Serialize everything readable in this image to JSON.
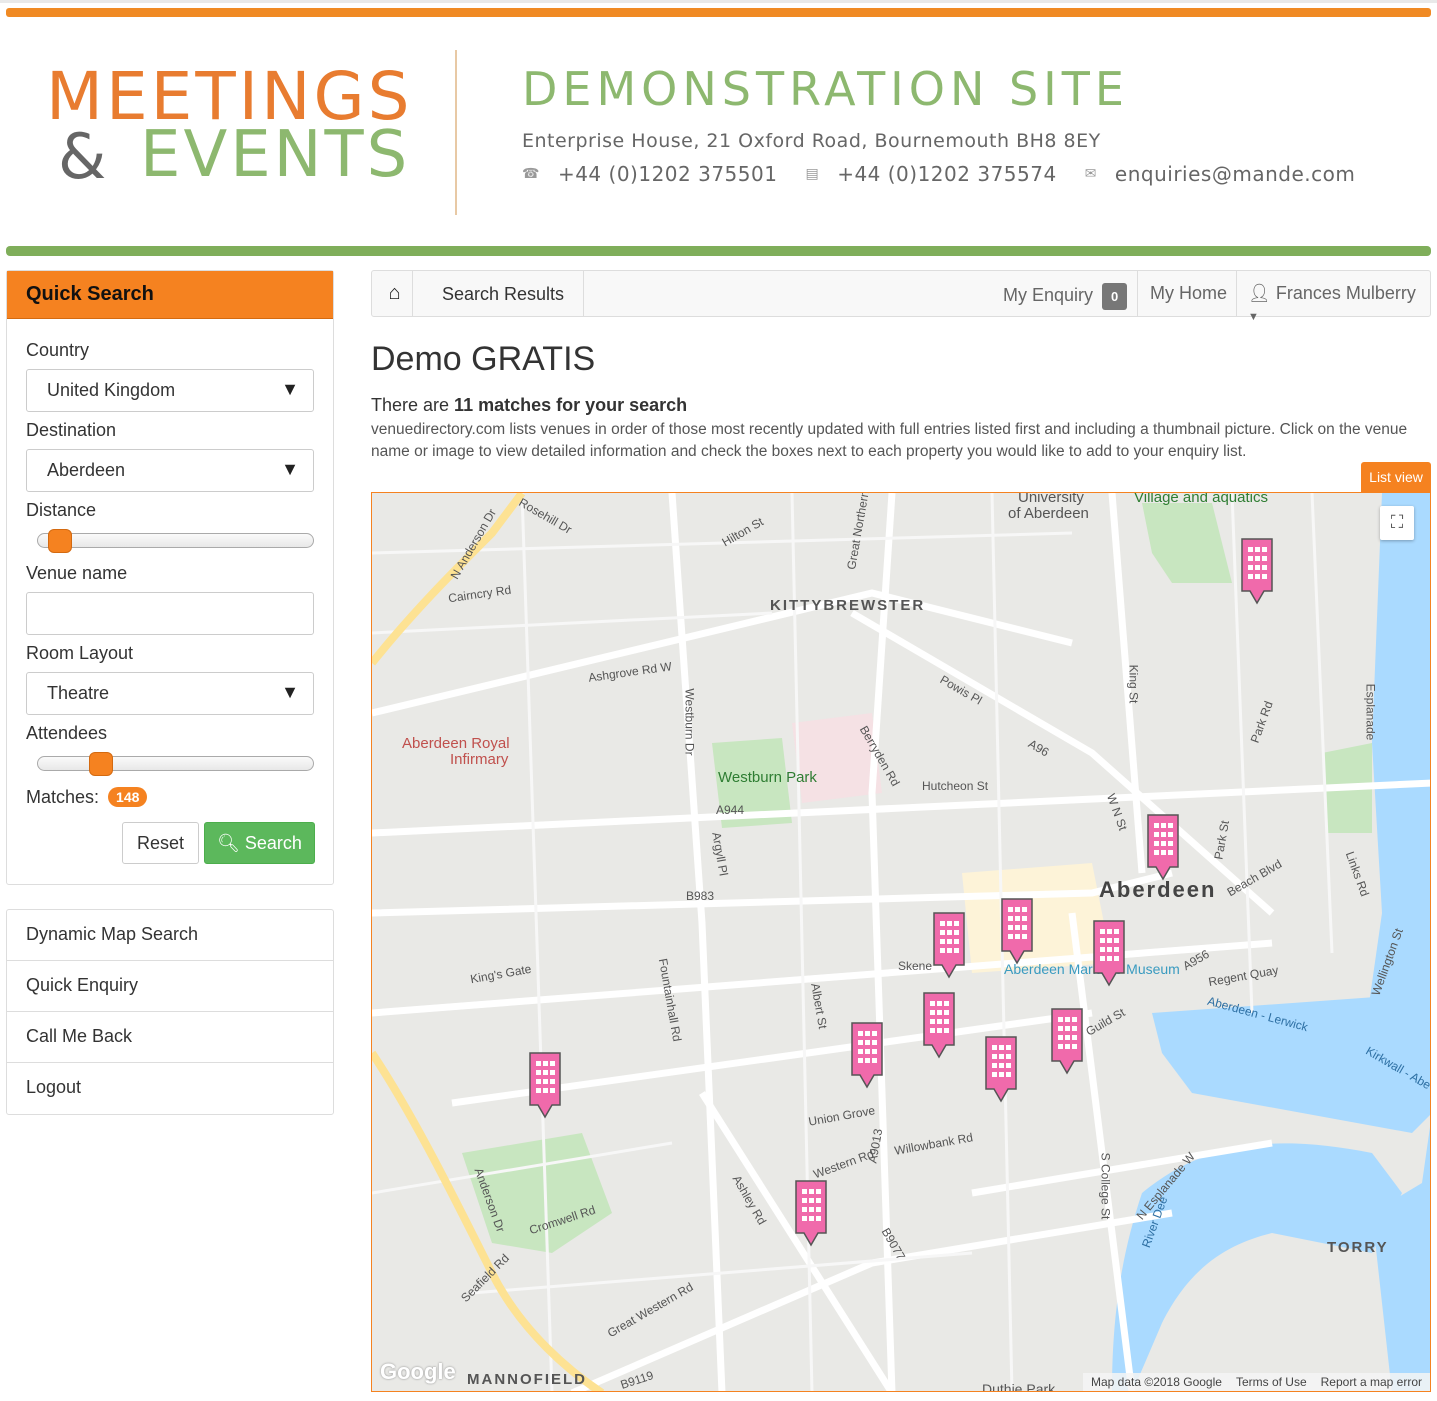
{
  "header": {
    "logo_line1": "MEETINGS",
    "logo_amp": "&",
    "logo_line2": "EVENTS",
    "site_title": "DEMONSTRATION SITE",
    "address": "Enterprise House, 21 Oxford Road, Bournemouth BH8 8EY",
    "phone": "+44 (0)1202 375501",
    "fax": "+44 (0)1202 375574",
    "email": "enquiries@mande.com"
  },
  "quick_search": {
    "title": "Quick Search",
    "country_label": "Country",
    "country_value": "United Kingdom",
    "destination_label": "Destination",
    "destination_value": "Aberdeen",
    "distance_label": "Distance",
    "distance_level": 0.08,
    "venue_label": "Venue name",
    "venue_value": "",
    "layout_label": "Room Layout",
    "layout_value": "Theatre",
    "attendees_label": "Attendees",
    "attendees_level": 0.23,
    "matches_label": "Matches:",
    "matches_count": "148",
    "reset_label": "Reset",
    "search_label": "Search"
  },
  "side_menu": [
    "Dynamic Map Search",
    "Quick Enquiry",
    "Call Me Back",
    "Logout"
  ],
  "nav": {
    "breadcrumb": "Search Results",
    "enquiry_label": "My Enquiry",
    "enquiry_count": "0",
    "home_label": "My Home",
    "user_name": "Frances Mulberry"
  },
  "main": {
    "title": "Demo GRATIS",
    "summary_prefix": "There are ",
    "summary_bold": "11 matches for your search",
    "description": "venuedirectory.com lists venues in order of those most recently updated with full entries listed first and including a thumbnail picture. Click on the venue name or image to view detailed information and check the boxes next to each property you would like to add to your enquiry list.",
    "list_view_label": "List view"
  },
  "map": {
    "labels": {
      "kittybrewster": "KITTYBREWSTER",
      "aberdeen": "Aberdeen",
      "torry": "TORRY",
      "mannofield": "MANNOFIELD",
      "westburn": "Westburn Park",
      "infirmary1": "Aberdeen Royal",
      "infirmary2": "Infirmary",
      "university1": "University",
      "university2": "of Aberdeen",
      "village": "Village and aquatics",
      "maritime": "Aberdeen Maritime Museum",
      "duthie": "Duthie Park",
      "hutcheon": "Hutcheon St",
      "powis": "Powis Pl",
      "a96": "A96",
      "a944": "A944",
      "b983": "B983",
      "b9119": "B9119",
      "union_grove": "Union Grove",
      "willowbank": "Willowbank Rd",
      "cromwell": "Cromwell Rd",
      "great_western": "Great Western Rd",
      "kings_gate": "King's Gate",
      "ashgrove": "Ashgrove Rd W",
      "cairncry": "Cairncry Rd",
      "anderson": "Anderson Dr",
      "regent_quay": "Regent Quay",
      "beach_blvd": "Beach Blvd",
      "guild": "Guild St",
      "a956": "A956",
      "esplanade": "Esplanade",
      "river_dee": "River Dee",
      "kings_st": "King St",
      "park_rd": "Park Rd",
      "hilton": "Hilton St",
      "rosehill": "Rosehill Dr",
      "n_anderson": "N Anderson Dr",
      "westburn_dr": "Westburn Dr",
      "berryden": "Berryden Rd",
      "argyll": "Argyll Pl",
      "fountainhall": "Fountainhall Rd",
      "albert": "Albert St",
      "ashley": "Ashley Rd",
      "s_college": "S College St",
      "a9013": "A9013",
      "b9077": "B9077",
      "western_rd": "Western Rd",
      "seafield": "Seafield Rd",
      "wellington": "Wellington St",
      "links_rd": "Links Rd",
      "kirkwall": "Kirkwall - Abe",
      "aberdeen_lerwick": "Aberdeen - Lerwick",
      "park_st": "Park St",
      "w_n_st": "W N St",
      "great_northern": "Great Northern",
      "n_esplanade": "N Esplanade W",
      "skene": "Skene"
    },
    "google_label": "Google",
    "map_data": "Map data ©2018 Google",
    "terms": "Terms of Use",
    "report": "Report a map error",
    "venue_pin_count": 11
  }
}
